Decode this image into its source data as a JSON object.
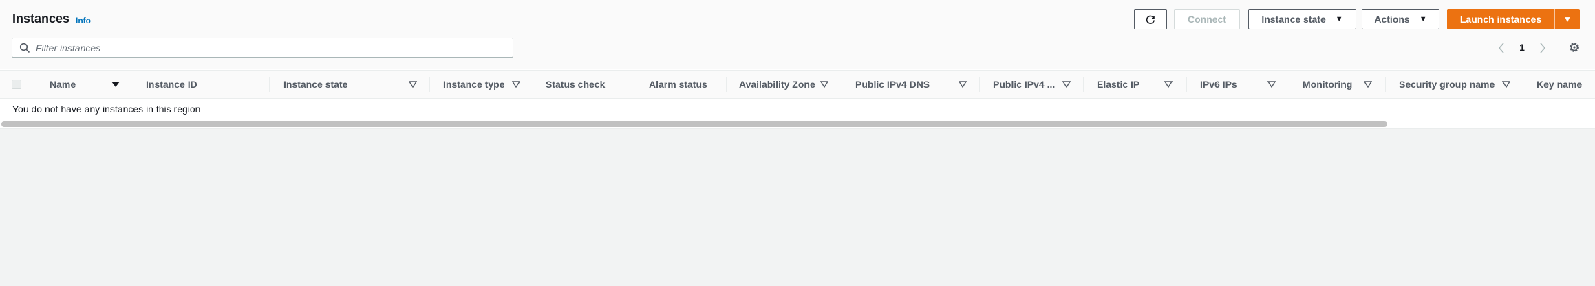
{
  "header": {
    "title": "Instances",
    "info_label": "Info"
  },
  "toolbar": {
    "refresh_icon": "refresh-icon",
    "connect_label": "Connect",
    "instance_state_label": "Instance state",
    "actions_label": "Actions",
    "launch_label": "Launch instances",
    "accent_color": "#ec7211"
  },
  "search": {
    "placeholder": "Filter instances",
    "value": ""
  },
  "pagination": {
    "current_page": "1"
  },
  "table": {
    "columns": [
      "Name",
      "Instance ID",
      "Instance state",
      "Instance type",
      "Status check",
      "Alarm status",
      "Availability Zone",
      "Public IPv4 DNS",
      "Public IPv4 ...",
      "Elastic IP",
      "IPv6 IPs",
      "Monitoring",
      "Security group name",
      "Key name"
    ],
    "empty_message": "You do not have any instances in this region"
  }
}
